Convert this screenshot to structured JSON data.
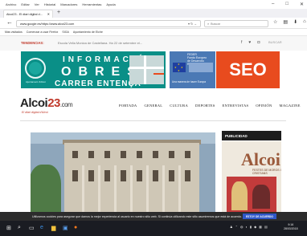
{
  "browser": {
    "menu": [
      "Archivo",
      "Editar",
      "Ver",
      "Historial",
      "Marcadores",
      "Herramientas",
      "Ayuda"
    ],
    "tab_title": "Alcoi23 - El diari digital d...",
    "url": "www.google.es/https://www.alcoi23.com",
    "search_placeholder": "Buscar",
    "bookmarks": [
      "Más visitados",
      "Comenzar a usar Firefox",
      "SIGA",
      "Ayuntamiento de Elche"
    ]
  },
  "site": {
    "tendencias_label": "TENDENCIAS:",
    "tendencias_text": "Escola Vella Moniza de Castellana. Ha 22 de setembre el...",
    "buscar": "BUSCAR",
    "banner1": {
      "line1": "INFORMACIÓ",
      "line2": "OBRES",
      "line3": "CARRER ENTENÇA",
      "ajuntament": "Ajuntament d'Alcoi"
    },
    "banner2": {
      "title": "FEDER\nFondo Europeo\nde Desarrollo\nRegional",
      "footer": "Una manera de hacer Europa"
    },
    "banner3": "SEO",
    "logo_main": "Alcoi",
    "logo_num": "23",
    "logo_com": ".com",
    "tagline": "El diari digital d'Alcoi",
    "nav": [
      "PORTADA",
      "GENERAL",
      "CULTURA",
      "DEPORTES",
      "ENTREVISTAS",
      "OPINIÓN",
      "MAGAZINE"
    ],
    "publicidad": "PUBLICIDAD",
    "ad_big": "Alcoi",
    "ad_sub": "FESTES DE MOROS I CRISTIANS"
  },
  "cookie": {
    "text": "Utilizamos cookies para asegurar que damos la mejor experiencia al usuario en nuestro sitio web. Si continúa utilizando este sitio asumiremos que está de acuerdo.",
    "button": "ESTOY DE ACUERDO"
  },
  "taskbar": {
    "time": "9:16",
    "date": "28/03/2018"
  }
}
